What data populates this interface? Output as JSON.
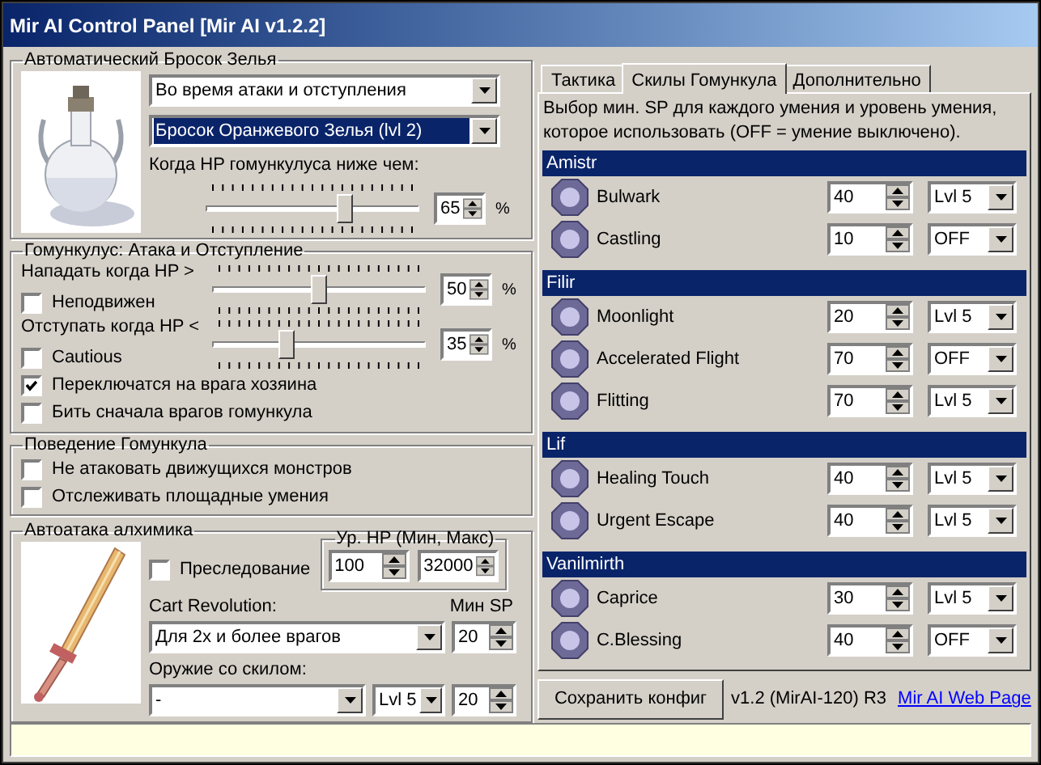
{
  "window": {
    "title": "Mir AI Control Panel [Mir AI v1.2.2]"
  },
  "potion": {
    "title": "Автоматический Бросок Зелья",
    "mode": {
      "value": "Во время атаки и отступления",
      "focused": false
    },
    "item": {
      "value": "Бросок Оранжевого Зелья (lvl 2)",
      "focused": true
    },
    "threshold_label": "Когда HP гомункулуса ниже чем:",
    "threshold": {
      "level": 0.65,
      "value": "65",
      "unit": "%"
    }
  },
  "attack_retreat": {
    "title": "Гомункулус: Атака и Отступление",
    "rules": [
      {
        "label": "Нападать когда HP >",
        "level": 0.5,
        "value": "50",
        "unit": "%",
        "option": {
          "label": "Неподвижен",
          "checked": false
        }
      },
      {
        "label": "Отступать когда HP <",
        "level": 0.35,
        "value": "35",
        "unit": "%",
        "option": {
          "label": "Cautious",
          "checked": false
        }
      }
    ],
    "options": [
      {
        "label": "Переключатся на врага хозяина",
        "checked": true
      },
      {
        "label": "Бить сначала врагов гомункула",
        "checked": false
      }
    ]
  },
  "behavior": {
    "title": "Поведение Гомункула",
    "options": [
      {
        "label": "Не атаковать движущихся монстров",
        "checked": false
      },
      {
        "label": "Отслеживать площадные умения",
        "checked": false
      }
    ]
  },
  "alchemist": {
    "title": "Автоатака алхимика",
    "chase": {
      "label": "Преследование",
      "checked": false
    },
    "hp_range": {
      "title": "Ур. HP (Мин, Макс)",
      "min": "100",
      "max": "32000"
    },
    "cart_revolution": {
      "label": "Cart Revolution:",
      "value": "Для 2х и более врагов"
    },
    "min_sp": {
      "label": "Мин SP",
      "value": "20"
    },
    "weapon_skill": {
      "label": "Оружие со скилом:",
      "value": "-",
      "skill_level": "Lvl 5",
      "sp": "20"
    }
  },
  "tabs": [
    {
      "label": "Тактика",
      "selected": false
    },
    {
      "label": "Скилы Гомункула",
      "selected": true
    },
    {
      "label": "Дополнительно",
      "selected": false
    }
  ],
  "skills_panel": {
    "description": "Выбор мин. SP для каждого умения и уровень умения, которое использовать (OFF = умение выключено).",
    "groups": [
      {
        "name": "Amistr",
        "skills": [
          {
            "name": "Bulwark",
            "sp": "40",
            "skill_level": "Lvl 5"
          },
          {
            "name": "Castling",
            "sp": "10",
            "skill_level": "OFF"
          }
        ]
      },
      {
        "name": "Filir",
        "skills": [
          {
            "name": "Moonlight",
            "sp": "20",
            "skill_level": "Lvl 5"
          },
          {
            "name": "Accelerated Flight",
            "sp": "70",
            "skill_level": "OFF"
          },
          {
            "name": "Flitting",
            "sp": "70",
            "skill_level": "Lvl 5"
          }
        ]
      },
      {
        "name": "Lif",
        "skills": [
          {
            "name": "Healing Touch",
            "sp": "40",
            "skill_level": "Lvl 5"
          },
          {
            "name": "Urgent Escape",
            "sp": "40",
            "skill_level": "Lvl 5"
          }
        ]
      },
      {
        "name": "Vanilmirth",
        "skills": [
          {
            "name": "Caprice",
            "sp": "30",
            "skill_level": "Lvl 5"
          },
          {
            "name": "C.Blessing",
            "sp": "40",
            "skill_level": "OFF"
          }
        ]
      }
    ]
  },
  "save_button": "Сохранить конфиг",
  "version": "v1.2 (MirAI-120) R3",
  "web_link": "Mir AI Web Page"
}
